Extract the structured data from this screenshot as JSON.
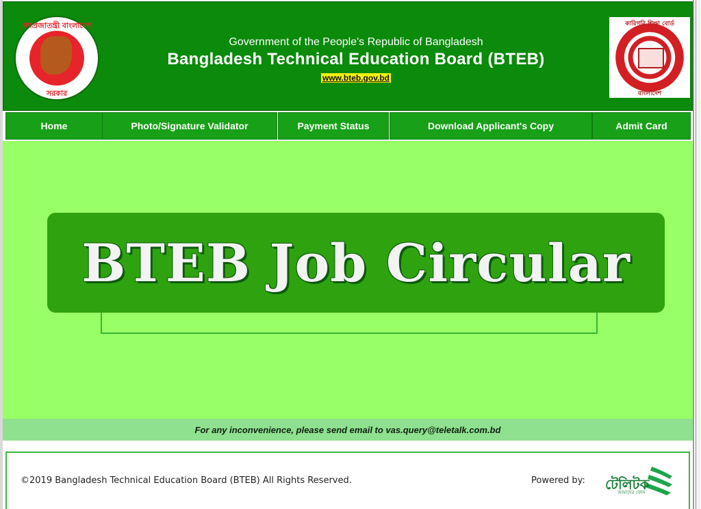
{
  "header": {
    "emblem_top_text": "গণপ্রজাতন্ত্রী বাংলাদেশ",
    "emblem_bottom_text": "সরকার",
    "government_line": "Government of the People's Republic of Bangladesh",
    "title": "Bangladesh Technical Education Board (BTEB)",
    "website": "www.bteb.gov.bd",
    "board_logo_top_text": "কারিগরি শিক্ষা বোর্ড",
    "board_logo_bottom_text": "বাংলাদেশ"
  },
  "nav": {
    "items": [
      {
        "label": "Home"
      },
      {
        "label": "Photo/Signature Validator"
      },
      {
        "label": "Payment Status"
      },
      {
        "label": "Download Applicant's Copy"
      },
      {
        "label": "Admit Card"
      }
    ]
  },
  "main": {
    "banner_text": "BTEB Job Circular"
  },
  "notice": {
    "text": "For any inconvenience, please send email to vas.query@teletalk.com.bd"
  },
  "footer": {
    "copyright": "©2019 Bangladesh Technical Education Board (BTEB) All Rights Reserved.",
    "powered_by": "Powered by:",
    "teletalk_logo_text": "টেলিটক",
    "teletalk_logo_sub": "আমাদের ফোন"
  },
  "colors": {
    "header_green": "#0b8a0b",
    "nav_green": "#18a018",
    "main_bg": "#99ff66",
    "banner_green": "#2fa30f",
    "notice_bg": "#8fe08f",
    "url_highlight": "#f2f20b"
  }
}
